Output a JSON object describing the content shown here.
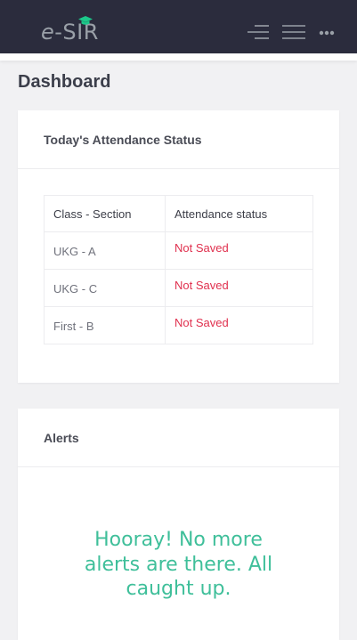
{
  "brand": {
    "name_e": "e",
    "name_rest": "-SIR",
    "accent": "#1cc88a"
  },
  "page": {
    "title": "Dashboard"
  },
  "attendance": {
    "title": "Today's Attendance Status",
    "columns": [
      "Class - Section",
      "Attendance status"
    ],
    "rows": [
      {
        "class_section": "UKG - A",
        "status": "Not Saved"
      },
      {
        "class_section": "UKG - C",
        "status": "Not Saved"
      },
      {
        "class_section": "First - B",
        "status": "Not Saved"
      }
    ],
    "status_color": "#e0304e"
  },
  "alerts": {
    "title": "Alerts",
    "message": "Hooray! No more alerts are there. All caught up.",
    "message_color": "#3fbf9a"
  },
  "icons": {
    "menu_left": "menu-lines-icon",
    "menu_right": "hamburger-icon",
    "more": "more-dots-icon",
    "logo_cap": "graduation-cap-icon"
  }
}
